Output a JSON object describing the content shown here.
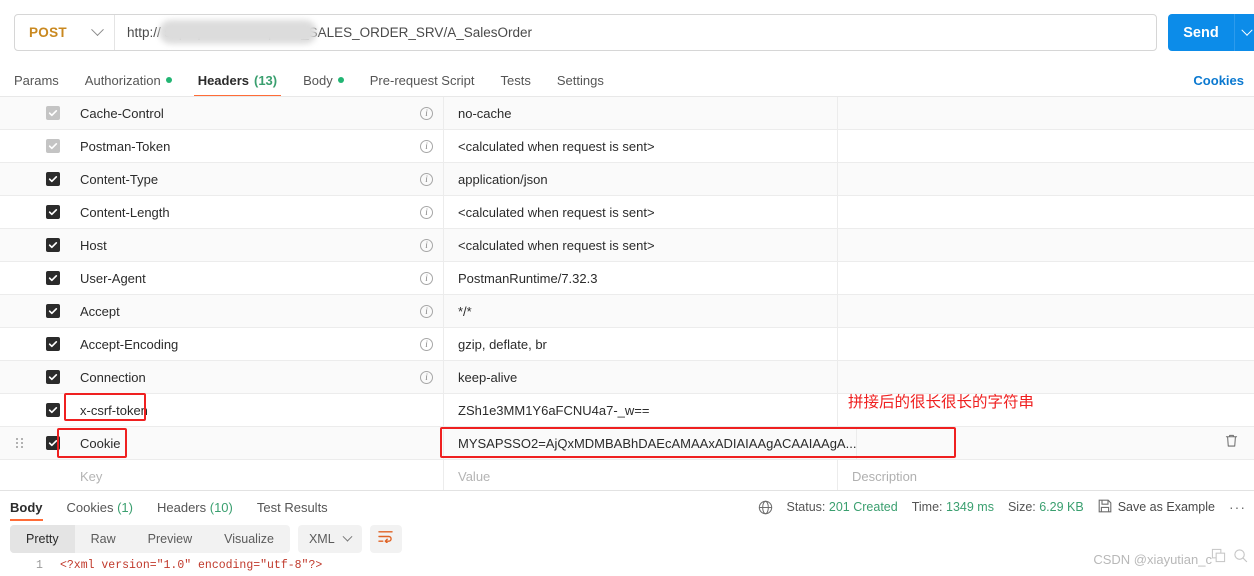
{
  "request": {
    "method": "POST",
    "url_text": "http://                            sap/opu/odata/sap/API_SALES_ORDER_SRV/A_SalesOrder",
    "url_prefix": "http://",
    "url_suffix": "sap/opu/odata/sap/API_SALES_ORDER_SRV/A_SalesOrder",
    "send_label": "Send",
    "cookies_link": "Cookies"
  },
  "request_tabs": [
    {
      "label": "Params",
      "dot": false,
      "count": "",
      "active": false
    },
    {
      "label": "Authorization",
      "dot": true,
      "count": "",
      "active": false
    },
    {
      "label": "Headers",
      "dot": false,
      "count": "(13)",
      "active": true
    },
    {
      "label": "Body",
      "dot": true,
      "count": "",
      "active": false
    },
    {
      "label": "Pre-request Script",
      "dot": false,
      "count": "",
      "active": false
    },
    {
      "label": "Tests",
      "dot": false,
      "count": "",
      "active": false
    },
    {
      "label": "Settings",
      "dot": false,
      "count": "",
      "active": false
    }
  ],
  "headers_table": {
    "placeholders": {
      "key": "Key",
      "value": "Value",
      "description": "Description"
    },
    "rows": [
      {
        "checked": "dim",
        "key": "Cache-Control",
        "info": true,
        "value": "no-cache"
      },
      {
        "checked": "dim",
        "key": "Postman-Token",
        "info": true,
        "value": "<calculated when request is sent>"
      },
      {
        "checked": "on",
        "key": "Content-Type",
        "info": true,
        "value": "application/json"
      },
      {
        "checked": "on",
        "key": "Content-Length",
        "info": true,
        "value": "<calculated when request is sent>"
      },
      {
        "checked": "on",
        "key": "Host",
        "info": true,
        "value": "<calculated when request is sent>"
      },
      {
        "checked": "on",
        "key": "User-Agent",
        "info": true,
        "value": "PostmanRuntime/7.32.3"
      },
      {
        "checked": "on",
        "key": "Accept",
        "info": true,
        "value": "*/*"
      },
      {
        "checked": "on",
        "key": "Accept-Encoding",
        "info": true,
        "value": "gzip, deflate, br"
      },
      {
        "checked": "on",
        "key": "Connection",
        "info": true,
        "value": "keep-alive"
      },
      {
        "checked": "on",
        "key": "x-csrf-token",
        "info": false,
        "value": "ZSh1e3MM1Y6aFCNU4a7-_w=="
      },
      {
        "checked": "on",
        "key": "Cookie",
        "info": false,
        "value": "MYSAPSSO2=AjQxMDMBABhDAEcAMAAxADIAIAAgACAAIAAgA..."
      }
    ]
  },
  "annotation": {
    "text": "拼接后的很长很长的字符串",
    "color": "#ef2020"
  },
  "response": {
    "tabs": [
      {
        "label": "Body",
        "count": "",
        "active": true
      },
      {
        "label": "Cookies",
        "count": "(1)",
        "active": false
      },
      {
        "label": "Headers",
        "count": "(10)",
        "active": false
      },
      {
        "label": "Test Results",
        "count": "",
        "active": false
      }
    ],
    "status_label": "Status:",
    "status_value": "201 Created",
    "time_label": "Time:",
    "time_value": "1349 ms",
    "size_label": "Size:",
    "size_value": "6.29 KB",
    "save_example": "Save as Example",
    "more": "···",
    "view_modes": [
      "Pretty",
      "Raw",
      "Preview",
      "Visualize"
    ],
    "active_view": "Pretty",
    "format": "XML",
    "code_line_number": "1",
    "code_text": "<?xml version=\"1.0\" encoding=\"utf-8\"?>"
  },
  "watermark": {
    "text": "CSDN @xiayutian_c"
  },
  "colors": {
    "accent_orange": "#ff6c37",
    "send_blue": "#0c8ce9",
    "method_amber": "#c9881f",
    "green": "#3a9f6f",
    "highlight_red": "#ef2020"
  }
}
